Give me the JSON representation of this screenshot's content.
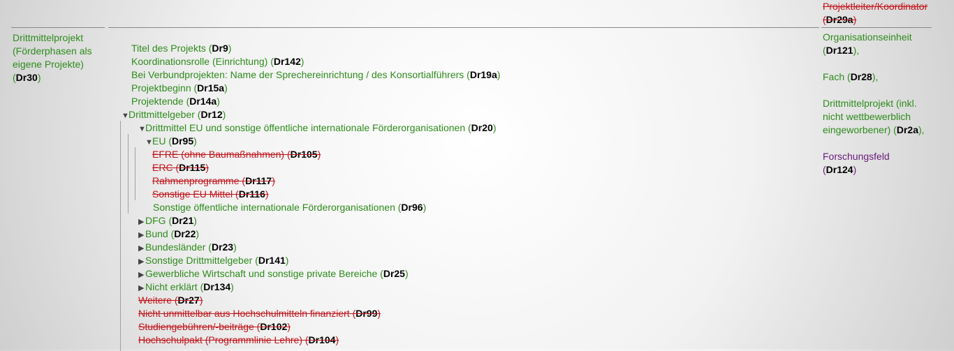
{
  "left": {
    "line1": "Drittmittelprojekt",
    "line2": "(Förderphasen als",
    "line3": "eigene Projekte)",
    "code": "Dr30"
  },
  "right": {
    "items": [
      {
        "label": "Projektleiter/Koordinator",
        "code": "Dr29a",
        "style": "struck"
      },
      {
        "label": "Organisationseinheit",
        "code": "Dr121",
        "style": "active"
      },
      {
        "label": "Fach",
        "code": "Dr28",
        "style": "active"
      },
      {
        "label_lines": [
          "Drittmittelprojekt (inkl.",
          "nicht wettbewerblich",
          "eingeworbener)"
        ],
        "code": "Dr2a",
        "style": "active"
      },
      {
        "label": "Forschungsfeld",
        "code": "Dr124",
        "style": "purple"
      }
    ]
  },
  "tree": [
    {
      "label": "Titel des Projekts",
      "code": "Dr9",
      "level": 0,
      "style": "active"
    },
    {
      "label": "Koordinationsrolle (Einrichtung)",
      "code": "Dr142",
      "level": 0,
      "style": "active"
    },
    {
      "label": "Bei Verbundprojekten: Name der Sprechereinrichtung / des Konsortialführers",
      "code": "Dr19a",
      "level": 0,
      "style": "active"
    },
    {
      "label": "Projektbeginn",
      "code": "Dr15a",
      "level": 0,
      "style": "active"
    },
    {
      "label": "Projektende",
      "code": "Dr14a",
      "level": 0,
      "style": "active"
    },
    {
      "label": "Drittmittelgeber",
      "code": "Dr12",
      "level": 0,
      "style": "active",
      "toggle": "expanded"
    },
    {
      "label": "Drittmittel EU und sonstige öffentliche internationale Förderorganisationen",
      "code": "Dr20",
      "level": 1,
      "style": "active",
      "toggle": "expanded"
    },
    {
      "label": "EU",
      "code": "Dr95",
      "level": 2,
      "style": "active",
      "toggle": "expanded"
    },
    {
      "label": "EFRE (ohne Baumaßnahmen)",
      "code": "Dr105",
      "level": 3,
      "style": "struck"
    },
    {
      "label": "ERC",
      "code": "Dr115",
      "level": 3,
      "style": "struck"
    },
    {
      "label": "Rahmenprogramme",
      "code": "Dr117",
      "level": 3,
      "style": "struck"
    },
    {
      "label": "Sonstige EU Mittel",
      "code": "Dr116",
      "level": 3,
      "style": "struck"
    },
    {
      "label": "Sonstige öffentliche internationale Förderorganisationen",
      "code": "Dr96",
      "level": 2,
      "style": "active"
    },
    {
      "label": "DFG",
      "code": "Dr21",
      "level": 1,
      "style": "active",
      "toggle": "collapsed"
    },
    {
      "label": "Bund",
      "code": "Dr22",
      "level": 1,
      "style": "active",
      "toggle": "collapsed"
    },
    {
      "label": "Bundesländer",
      "code": "Dr23",
      "level": 1,
      "style": "active",
      "toggle": "collapsed"
    },
    {
      "label": "Sonstige Drittmittelgeber",
      "code": "Dr141",
      "level": 1,
      "style": "active",
      "toggle": "collapsed"
    },
    {
      "label": "Gewerbliche Wirtschaft und sonstige private Bereiche",
      "code": "Dr25",
      "level": 1,
      "style": "active",
      "toggle": "collapsed"
    },
    {
      "label": "Nicht erklärt",
      "code": "Dr134",
      "level": 1,
      "style": "active",
      "toggle": "collapsed"
    },
    {
      "label": "Weitere",
      "code": "Dr27",
      "level": 1,
      "style": "struck"
    },
    {
      "label": "Nicht unmittelbar aus Hochschulmitteln finanziert",
      "code": "Dr99",
      "level": 1,
      "style": "struck"
    },
    {
      "label": "Studiengebühren/-beiträge",
      "code": "Dr102",
      "level": 1,
      "style": "struck"
    },
    {
      "label": "Hochschulpakt (Programmlinie Lehre)",
      "code": "Dr104",
      "level": 1,
      "style": "struck"
    }
  ]
}
